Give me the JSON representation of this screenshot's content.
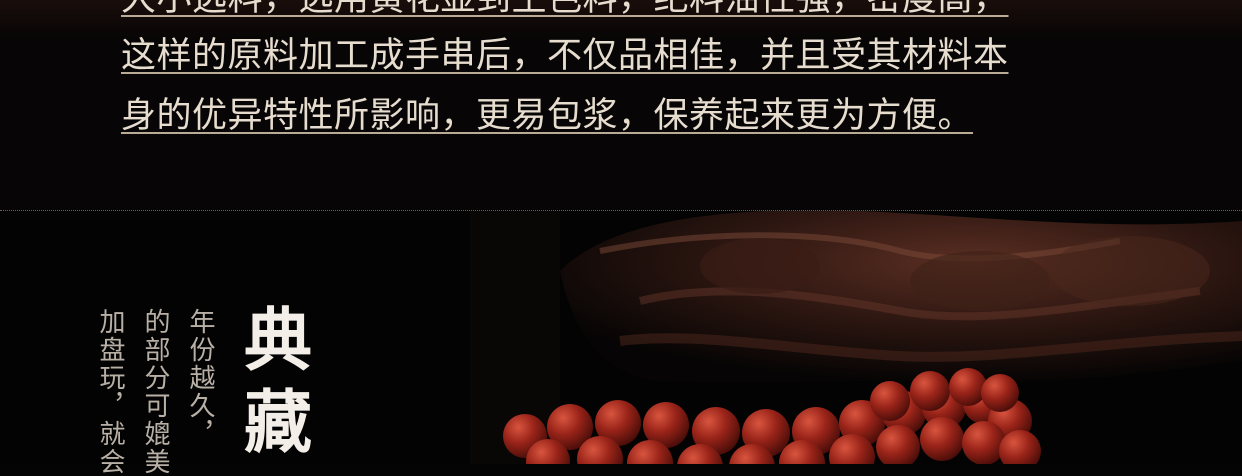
{
  "intro": {
    "lines": [
      "大小选料，选用黄花显到生色料，纪料油性强，密度高，",
      "这样的原料加工成手串后，不仅品相佳，并且受其材料本",
      "身的优异特性所影响，更易包浆，保养起来更为方便。"
    ]
  },
  "feature": {
    "title_chars": [
      "典",
      "藏"
    ],
    "columns": [
      "年份越久，",
      "的部分可媲美",
      "加盘玩，就会"
    ]
  },
  "colors": {
    "text": "#e7ddcf",
    "underline": "#b9ab95",
    "background": "#050404",
    "bead": "#8c1e16"
  }
}
